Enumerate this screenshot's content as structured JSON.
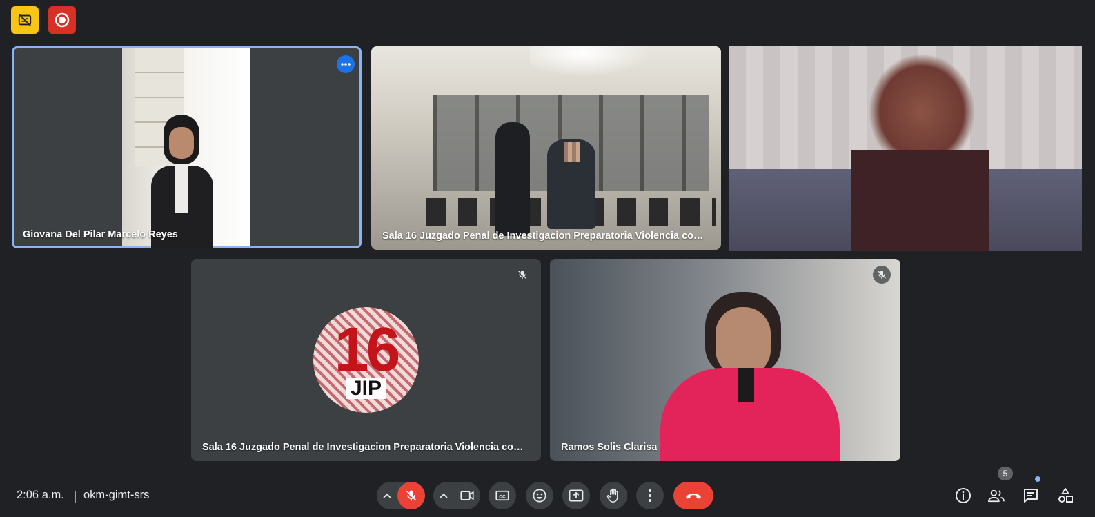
{
  "top_bar": {
    "icons": [
      {
        "name": "captions-off-icon",
        "color": "#f9c514"
      },
      {
        "name": "recording-icon",
        "color": "#d93025"
      }
    ]
  },
  "tiles": [
    {
      "name": "Giovana Del Pilar Marcelo Reyes",
      "active": true,
      "has_more_options": true
    },
    {
      "name": "Sala 16 Juzgado Penal de Investigacion Preparatoria Violencia contr…",
      "muted": false
    },
    {
      "name": "",
      "pixelated": true
    },
    {
      "name": "Sala 16 Juzgado Penal de Investigacion Preparatoria Violencia contr…",
      "muted": true,
      "avatar_logo": {
        "number": "16",
        "text": "JIP"
      }
    },
    {
      "name": "Ramos Solis Clarisa",
      "muted": true
    }
  ],
  "bottom_bar": {
    "time": "2:06 a.m.",
    "meeting_code": "okm-gimt-srs",
    "controls": [
      "mic-options",
      "mic-muted",
      "camera-options",
      "camera",
      "captions",
      "emoji",
      "present",
      "raise-hand",
      "more-options",
      "leave-call"
    ],
    "participants_count": "5",
    "colors": {
      "leave": "#ea4335",
      "accent": "#8ab4f8",
      "active_border": "#8ab4f8"
    }
  }
}
